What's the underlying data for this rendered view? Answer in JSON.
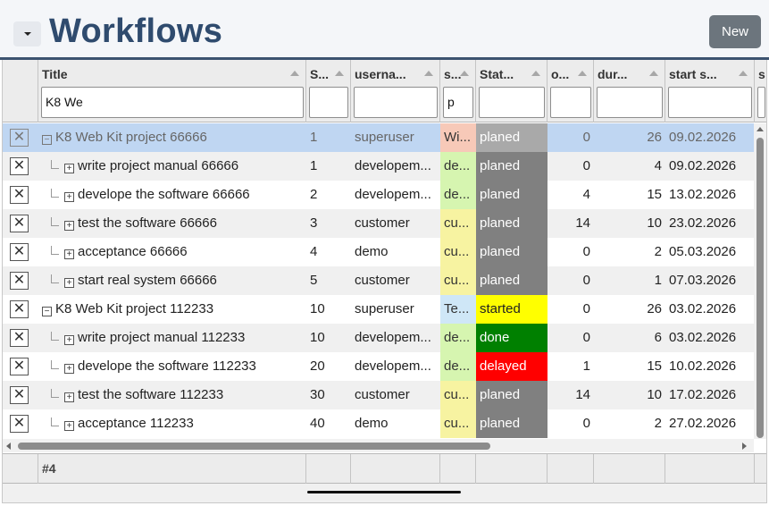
{
  "header": {
    "title": "Workflows",
    "new_label": "New",
    "collapse_icon": "caret-down-icon"
  },
  "columns": [
    {
      "key": "del",
      "title": "",
      "filter": null
    },
    {
      "key": "title",
      "title": "Title",
      "filter": "K8 We"
    },
    {
      "key": "seq",
      "title": "S...",
      "filter": ""
    },
    {
      "key": "username",
      "title": "userna...",
      "filter": ""
    },
    {
      "key": "s",
      "title": "s...",
      "filter": "p"
    },
    {
      "key": "status",
      "title": "Stat...",
      "filter": ""
    },
    {
      "key": "o",
      "title": "o...",
      "filter": ""
    },
    {
      "key": "duration",
      "title": "dur...",
      "filter": ""
    },
    {
      "key": "start",
      "title": "start s...",
      "filter": ""
    },
    {
      "key": "more",
      "title": "s",
      "filter": ""
    }
  ],
  "rows": [
    {
      "level": 0,
      "title": "K8 Web Kit project 66666",
      "seq": "1",
      "username": "superuser",
      "s": "Wi...",
      "s_color": "#f7c9b8",
      "status": "planed",
      "status_color": "#a9a9a9",
      "o": "0",
      "duration": "26",
      "start": "09.02.2026",
      "selected": true
    },
    {
      "level": 1,
      "title": "write project manual 66666",
      "seq": "1",
      "username": "developem...",
      "s": "de...",
      "s_color": "#d6f5b0",
      "status": "planed",
      "status_color": "#808080",
      "o": "0",
      "duration": "4",
      "start": "09.02.2026",
      "selected": false
    },
    {
      "level": 1,
      "title": "develope the software 66666",
      "seq": "2",
      "username": "developem...",
      "s": "de...",
      "s_color": "#d6f5b0",
      "status": "planed",
      "status_color": "#808080",
      "o": "4",
      "duration": "15",
      "start": "13.02.2026",
      "selected": false
    },
    {
      "level": 1,
      "title": "test the software 66666",
      "seq": "3",
      "username": "customer",
      "s": "cu...",
      "s_color": "#f7f3a1",
      "status": "planed",
      "status_color": "#808080",
      "o": "14",
      "duration": "10",
      "start": "23.02.2026",
      "selected": false
    },
    {
      "level": 1,
      "title": "acceptance 66666",
      "seq": "4",
      "username": "demo",
      "s": "cu...",
      "s_color": "#f7f3a1",
      "status": "planed",
      "status_color": "#808080",
      "o": "0",
      "duration": "2",
      "start": "05.03.2026",
      "selected": false
    },
    {
      "level": 1,
      "title": "start real system 66666",
      "seq": "5",
      "username": "customer",
      "s": "cu...",
      "s_color": "#f7f3a1",
      "status": "planed",
      "status_color": "#808080",
      "o": "0",
      "duration": "1",
      "start": "07.03.2026",
      "selected": false
    },
    {
      "level": 0,
      "title": "K8 Web Kit project 112233",
      "seq": "10",
      "username": "superuser",
      "s": "Te...",
      "s_color": "#cfe7f7",
      "status": "started",
      "status_color": "#ffff00",
      "status_text_color": "#222222",
      "o": "0",
      "duration": "26",
      "start": "03.02.2026",
      "selected": false
    },
    {
      "level": 1,
      "title": "write project manual 112233",
      "seq": "10",
      "username": "developem...",
      "s": "de...",
      "s_color": "#d6f5b0",
      "status": "done",
      "status_color": "#008000",
      "o": "0",
      "duration": "6",
      "start": "03.02.2026",
      "selected": false
    },
    {
      "level": 1,
      "title": "develope the software 112233",
      "seq": "20",
      "username": "developem...",
      "s": "de...",
      "s_color": "#d6f5b0",
      "status": "delayed",
      "status_color": "#ff0000",
      "o": "1",
      "duration": "15",
      "start": "10.02.2026",
      "selected": false
    },
    {
      "level": 1,
      "title": "test the software 112233",
      "seq": "30",
      "username": "customer",
      "s": "cu...",
      "s_color": "#f7f3a1",
      "status": "planed",
      "status_color": "#808080",
      "o": "14",
      "duration": "10",
      "start": "17.02.2026",
      "selected": false
    },
    {
      "level": 1,
      "title": "acceptance 112233",
      "seq": "40",
      "username": "demo",
      "s": "cu...",
      "s_color": "#f7f3a1",
      "status": "planed",
      "status_color": "#808080",
      "o": "0",
      "duration": "2",
      "start": "27.02.2026",
      "selected": false
    }
  ],
  "footer": {
    "count": "#4"
  }
}
